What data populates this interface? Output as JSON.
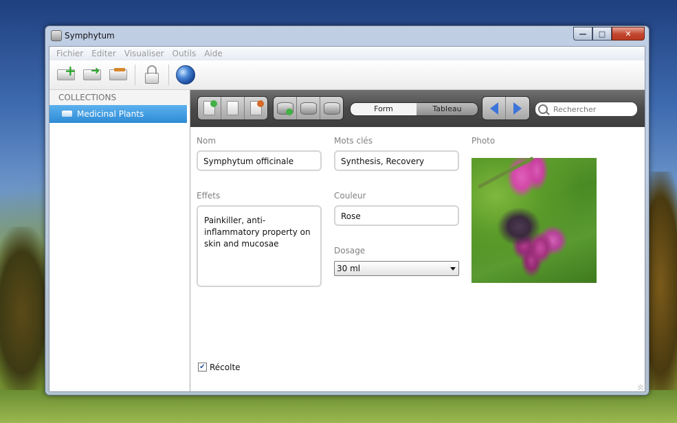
{
  "window": {
    "title": "Symphytum"
  },
  "menu": [
    "Fichier",
    "Editer",
    "Visualiser",
    "Outils",
    "Aide"
  ],
  "toolbar": {
    "buttons": [
      "new-collection-icon",
      "duplicate-collection-icon",
      "delete-collection-icon",
      "lock-icon",
      "globe-icon"
    ]
  },
  "sidebar": {
    "header": "COLLECTIONS",
    "items": [
      {
        "label": "Medicinal Plants",
        "selected": true
      }
    ]
  },
  "view": {
    "modes": [
      "Form",
      "Tableau"
    ],
    "selected_mode": "Form",
    "search_placeholder": "Rechercher"
  },
  "form": {
    "nom": {
      "label": "Nom",
      "value": "Symphytum officinale"
    },
    "mots_cles": {
      "label": "Mots clés",
      "value": "Synthesis, Recovery"
    },
    "photo": {
      "label": "Photo"
    },
    "effets": {
      "label": "Effets",
      "value": "Painkiller, anti-inflammatory property on skin and mucosae"
    },
    "couleur": {
      "label": "Couleur",
      "value": "Rose"
    },
    "dosage": {
      "label": "Dosage",
      "value": "30 ml"
    },
    "recolte": {
      "label": "Récolte",
      "checked": true
    }
  },
  "colors": {
    "accent": "#2d8bd6",
    "close_button": "#c2452d",
    "toolbar_dark": "#4a4a4a"
  }
}
